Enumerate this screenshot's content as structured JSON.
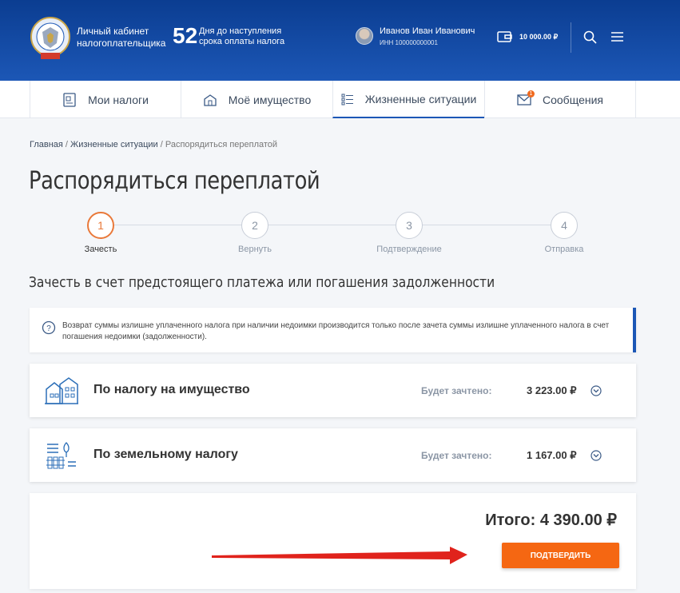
{
  "header": {
    "brand_line1": "Личный кабинет",
    "brand_line2": "налогоплательщика",
    "days_count": "52",
    "days_line1": "Дня до наступления",
    "days_line2": "срока оплаты налога",
    "user_name": "Иванов Иван Иванович",
    "user_inn": "ИНН 100000000001",
    "balance": "10 000.00 ₽"
  },
  "nav": {
    "tabs": [
      {
        "label": "Мои налоги",
        "icon": "taxes-icon"
      },
      {
        "label": "Моё имущество",
        "icon": "property-icon"
      },
      {
        "label": "Жизненные ситуации",
        "icon": "list-icon",
        "active": true
      },
      {
        "label": "Сообщения",
        "icon": "mail-icon"
      }
    ],
    "messages_badge": "1"
  },
  "breadcrumb": {
    "home": "Главная",
    "sep1": " / ",
    "section": "Жизненные ситуации",
    "sep2": " / ",
    "current": "Распорядиться переплатой"
  },
  "page_title": "Распорядиться переплатой",
  "steps": [
    {
      "num": "1",
      "label": "Зачесть",
      "active": true
    },
    {
      "num": "2",
      "label": "Вернуть"
    },
    {
      "num": "3",
      "label": "Подтверждение"
    },
    {
      "num": "4",
      "label": "Отправка"
    }
  ],
  "section_title": "Зачесть в счет предстоящего платежа или погашения задолженности",
  "info": {
    "text": "Возврат суммы излишне уплаченного налога при наличии недоимки производится только после зачета суммы излишне уплаченного налога в счет погашения недоимки (задолженности)."
  },
  "cards": [
    {
      "title": "По налогу на имущество",
      "label": "Будет зачтено:",
      "amount": "3 223.00 ₽",
      "icon": "house-icon"
    },
    {
      "title": "По земельному налогу",
      "label": "Будет зачтено:",
      "amount": "1 167.00 ₽",
      "icon": "land-icon"
    }
  ],
  "total": "Итого: 4 390.00 ₽",
  "confirm_label": "ПОДТВЕРДИТЬ",
  "colors": {
    "header": "#1c57b6",
    "accent": "#f56712",
    "step_active": "#e9793a",
    "arrow": "#e0231c"
  }
}
